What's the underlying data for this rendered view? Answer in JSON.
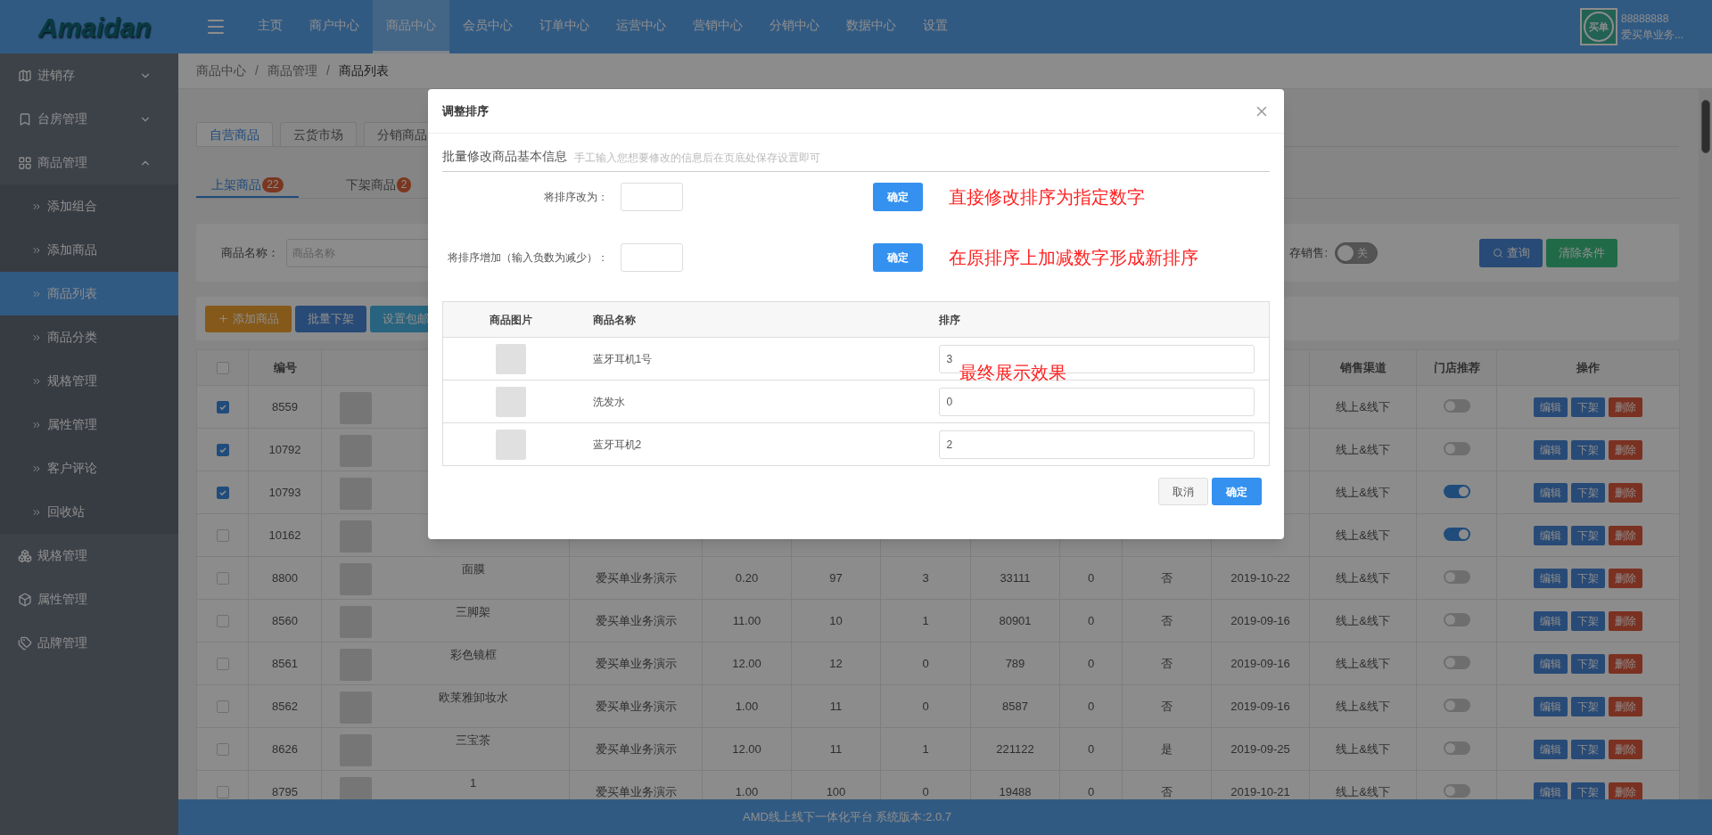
{
  "header": {
    "logo": "Amaidan",
    "nav": [
      {
        "label": "主页",
        "selected": false
      },
      {
        "label": "商户中心",
        "selected": false
      },
      {
        "label": "商品中心",
        "selected": true
      },
      {
        "label": "会员中心",
        "selected": false
      },
      {
        "label": "订单中心",
        "selected": false
      },
      {
        "label": "运营中心",
        "selected": false
      },
      {
        "label": "营销中心",
        "selected": false
      },
      {
        "label": "分销中心",
        "selected": false
      },
      {
        "label": "数据中心",
        "selected": false
      },
      {
        "label": "设置",
        "selected": false
      }
    ],
    "user": {
      "avatar_text": "买单",
      "id": "88888888",
      "name": "爱买单业务..."
    }
  },
  "sidebar": {
    "items": [
      {
        "label": "进销存",
        "expanded": false
      },
      {
        "label": "台房管理",
        "expanded": false
      },
      {
        "label": "商品管理",
        "expanded": true,
        "children": [
          {
            "label": "添加组合",
            "selected": false
          },
          {
            "label": "添加商品",
            "selected": false
          },
          {
            "label": "商品列表",
            "selected": true
          },
          {
            "label": "商品分类",
            "selected": false
          },
          {
            "label": "规格管理",
            "selected": false
          },
          {
            "label": "属性管理",
            "selected": false
          },
          {
            "label": "客户评论",
            "selected": false
          },
          {
            "label": "回收站",
            "selected": false
          }
        ]
      },
      {
        "label": "规格管理"
      },
      {
        "label": "属性管理"
      },
      {
        "label": "品牌管理"
      }
    ]
  },
  "breadcrumb": [
    {
      "label": "商品中心"
    },
    {
      "separator": "/",
      "label": "商品管理"
    },
    {
      "separator": "/",
      "label": "商品列表"
    }
  ],
  "source_tabs": [
    {
      "label": "自营商品",
      "selected": true
    },
    {
      "label": "云货市场",
      "selected": false
    },
    {
      "label": "分销商品",
      "selected": false
    }
  ],
  "status_tabs": [
    {
      "label": "上架商品",
      "count": "22",
      "selected": true
    },
    {
      "label": "下架商品",
      "count": "2",
      "selected": false
    }
  ],
  "filters": {
    "name_label": "商品名称：",
    "name_placeholder": "商品名称",
    "stock_label": "存销售:",
    "stock_switch": {
      "on": false,
      "text": "关"
    },
    "buttons": [
      "查询",
      "清除条件"
    ]
  },
  "toolbar": [
    "添加商品",
    "批量下架",
    "设置包邮"
  ],
  "table": {
    "all_checked": false,
    "columns": [
      "",
      "编号",
      "",
      "",
      "",
      "",
      "",
      "",
      "",
      "",
      "",
      "销售渠道",
      "门店推荐",
      "操作"
    ],
    "rows": [
      {
        "checked": true,
        "id": "8559",
        "channel": "线上&线下",
        "recommended": false,
        "actions": [
          "编辑",
          "下架",
          "删除"
        ]
      },
      {
        "checked": true,
        "id": "10792",
        "channel": "线上&线下",
        "recommended": false,
        "actions": [
          "编辑",
          "下架",
          "删除"
        ]
      },
      {
        "checked": true,
        "id": "10793",
        "channel": "线上&线下",
        "recommended": true,
        "actions": [
          "编辑",
          "下架",
          "删除"
        ]
      },
      {
        "checked": false,
        "id": "10162",
        "channel": "线上&线下",
        "recommended": true,
        "actions": [
          "编辑",
          "下架",
          "删除"
        ]
      },
      {
        "checked": false,
        "id": "8800",
        "name": "面膜",
        "cells": [
          "爱买单业务演示",
          "0.20",
          "97",
          "3",
          "33111",
          "0",
          "否",
          "2019-10-22"
        ],
        "channel": "线上&线下",
        "recommended": false,
        "actions": [
          "编辑",
          "下架",
          "删除"
        ]
      },
      {
        "checked": false,
        "id": "8560",
        "name": "三脚架",
        "cells": [
          "爱买单业务演示",
          "11.00",
          "10",
          "1",
          "80901",
          "0",
          "否",
          "2019-09-16"
        ],
        "channel": "线上&线下",
        "recommended": false,
        "actions": [
          "编辑",
          "下架",
          "删除"
        ]
      },
      {
        "checked": false,
        "id": "8561",
        "name": "彩色镜框",
        "cells": [
          "爱买单业务演示",
          "12.00",
          "12",
          "0",
          "789",
          "0",
          "否",
          "2019-09-16"
        ],
        "channel": "线上&线下",
        "recommended": false,
        "actions": [
          "编辑",
          "下架",
          "删除"
        ]
      },
      {
        "checked": false,
        "id": "8562",
        "name": "欧莱雅卸妆水",
        "cells": [
          "爱买单业务演示",
          "1.00",
          "11",
          "0",
          "8587",
          "0",
          "否",
          "2019-09-16"
        ],
        "channel": "线上&线下",
        "recommended": false,
        "actions": [
          "编辑",
          "下架",
          "删除"
        ]
      },
      {
        "checked": false,
        "id": "8626",
        "name": "三宝茶",
        "cells": [
          "爱买单业务演示",
          "12.00",
          "11",
          "1",
          "221122",
          "0",
          "是",
          "2019-09-25"
        ],
        "channel": "线上&线下",
        "recommended": false,
        "actions": [
          "编辑",
          "下架",
          "删除"
        ]
      },
      {
        "checked": false,
        "id": "8795",
        "name": "1",
        "cells": [
          "爱买单业务演示",
          "1.00",
          "100",
          "0",
          "19488",
          "0",
          "否",
          "2019-10-21"
        ],
        "channel": "线上&线下",
        "recommended": false,
        "actions": [
          "编辑",
          "下架",
          "删除"
        ]
      }
    ]
  },
  "footer": "AMD线上线下一体化平台 系统版本:2.0.7",
  "dialog": {
    "title": "调整排序",
    "section": "批量修改商品基本信息",
    "hint": "手工输入您想要修改的信息后在页底处保存设置即可",
    "forms": [
      {
        "label": "将排序改为：",
        "button": "确定",
        "note": "直接修改排序为指定数字"
      },
      {
        "label": "将排序增加（输入负数为减少）：",
        "button": "确定",
        "note": "在原排序上加减数字形成新排序"
      }
    ],
    "columns": [
      "商品图片",
      "商品名称",
      "排序"
    ],
    "rows": [
      {
        "name": "蓝牙耳机1号",
        "sort": "3"
      },
      {
        "name": "洗发水",
        "sort": "0"
      },
      {
        "name": "蓝牙耳机2",
        "sort": "2"
      }
    ],
    "note": "最终展示效果",
    "buttons": [
      "取消",
      "确定"
    ]
  }
}
